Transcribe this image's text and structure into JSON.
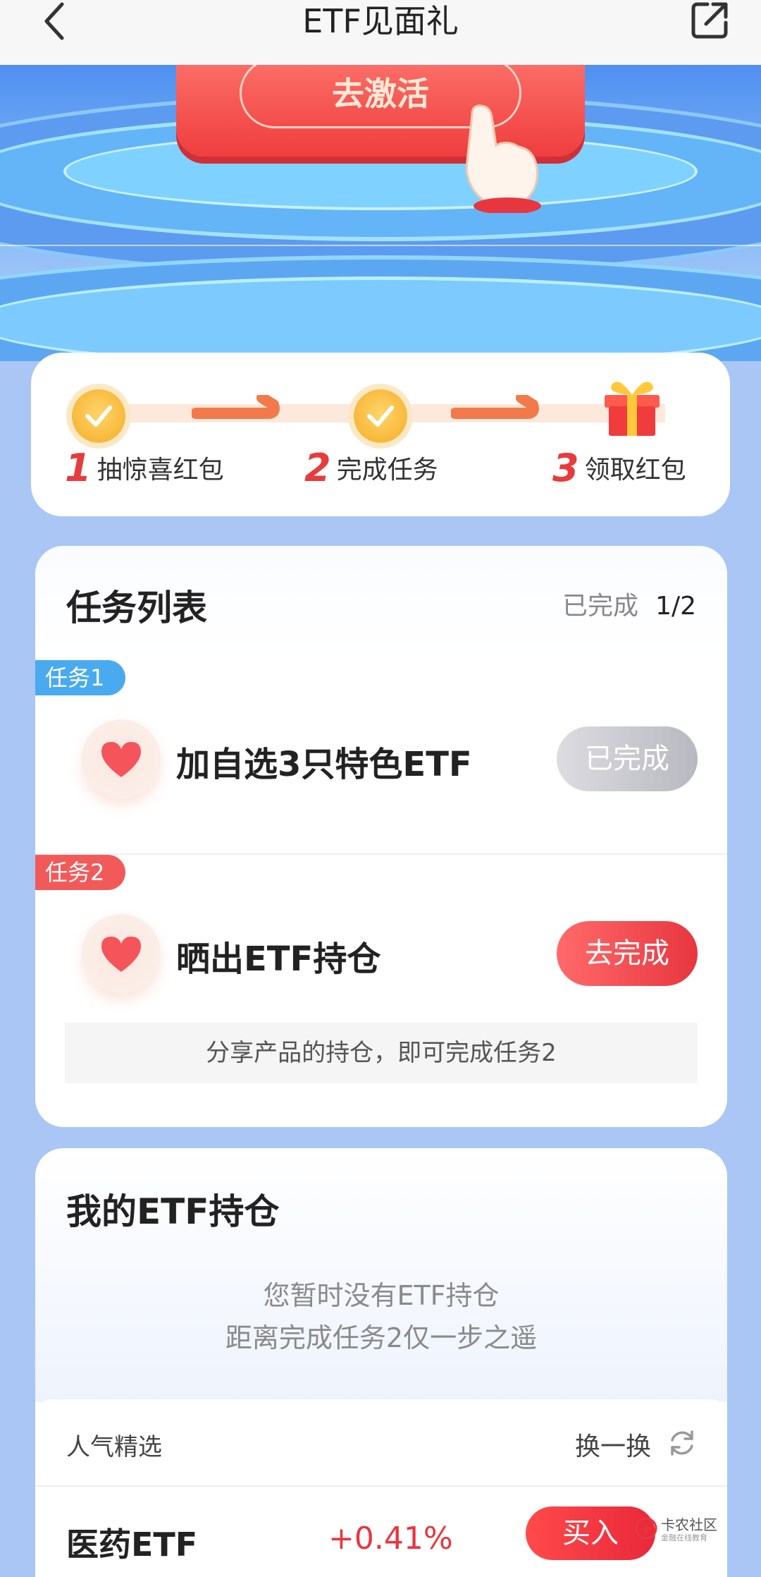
{
  "header": {
    "title": "ETF见面礼"
  },
  "hero": {
    "activate_label": "去激活"
  },
  "steps": [
    {
      "num": "1",
      "label": "抽惊喜红包"
    },
    {
      "num": "2",
      "label": "完成任务"
    },
    {
      "num": "3",
      "label": "领取红包"
    }
  ],
  "tasks": {
    "title": "任务列表",
    "progress_label": "已完成",
    "progress_value": "1/2",
    "items": [
      {
        "tag": "任务1",
        "name": "加自选3只特色ETF",
        "button": "已完成"
      },
      {
        "tag": "任务2",
        "name": "晒出ETF持仓",
        "button": "去完成"
      }
    ],
    "hint": "分享产品的持仓，即可完成任务2"
  },
  "holdings": {
    "title": "我的ETF持仓",
    "empty_line1": "您暂时没有ETF持仓",
    "empty_line2": "距离完成任务2仅一步之遥",
    "picks_label": "人气精选",
    "refresh_label": "换一换",
    "fund": {
      "name": "医药ETF",
      "change": "+0.41%",
      "buy_label": "买入"
    }
  },
  "watermark": {
    "title": "卡农社区",
    "subtitle": "金融在线教育"
  },
  "colors": {
    "accent_red": "#e8363f",
    "task1_tag": "#4aaaf0",
    "task2_tag": "#f25a5a",
    "page_bg": "#a9c6f5"
  },
  "icons": [
    "back-arrow-icon",
    "share-icon",
    "check-icon",
    "arrow-right-icon",
    "gift-icon",
    "heart-icon",
    "refresh-icon",
    "watermark-logo-icon"
  ]
}
